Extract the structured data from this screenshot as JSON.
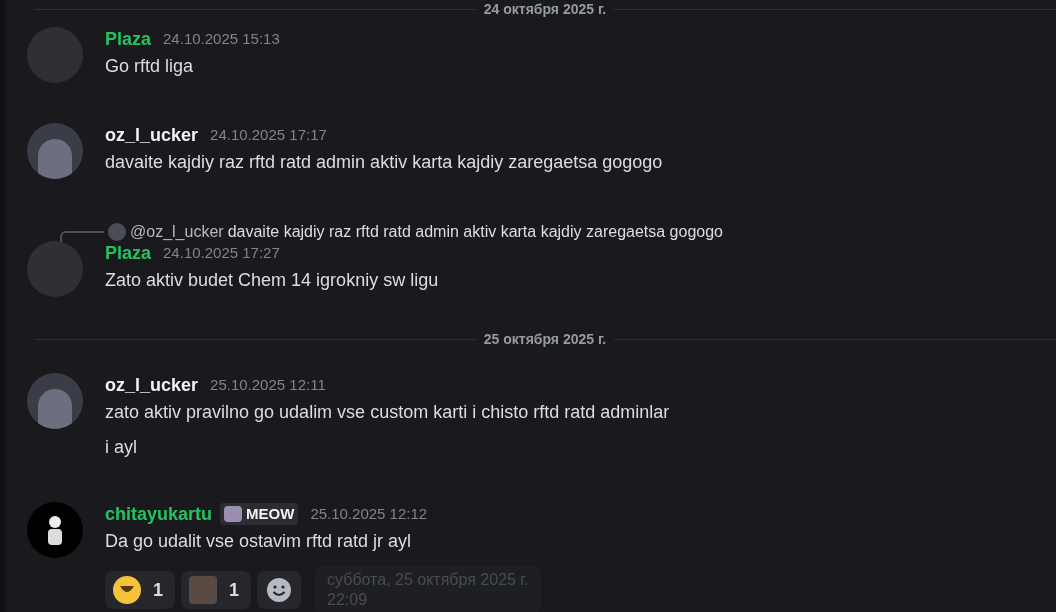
{
  "top_divider": {
    "label": "24 октября 2025 г."
  },
  "messages": [
    {
      "author": "Plaza",
      "color": "#23c45e",
      "timestamp": "24.10.2025 15:13",
      "avatar": {
        "kind": "blank"
      },
      "lines": [
        "Go rftd liga"
      ]
    },
    {
      "author": "oz_l_ucker",
      "color": "#f2f3f5",
      "timestamp": "24.10.2025 17:17",
      "avatar": {
        "kind": "image"
      },
      "lines": [
        "davaite kajdiy raz rftd ratd admin aktiv karta  kajdiy zaregaetsa gogogo"
      ]
    },
    {
      "author": "Plaza",
      "color": "#23c45e",
      "timestamp": "24.10.2025 17:27",
      "avatar": {
        "kind": "blank"
      },
      "reply": {
        "mention": "@oz_l_ucker",
        "text": "davaite kajdiy raz rftd ratd admin aktiv karta  kajdiy zaregaetsa gogogo"
      },
      "lines": [
        "Zato aktiv budet Chem 14 igrokniy sw ligu"
      ]
    },
    {
      "divider": "25 октября 2025 г.",
      "author": "oz_l_ucker",
      "color": "#f2f3f5",
      "timestamp": "25.10.2025 12:11",
      "avatar": {
        "kind": "image"
      },
      "lines": [
        "zato aktiv pravilno go udalim vse custom karti i chisto rftd ratd adminlar",
        "i ayl"
      ]
    },
    {
      "author": "chitayukartu",
      "color": "#23c45e",
      "timestamp": "25.10.2025 12:12",
      "avatar": {
        "kind": "dark"
      },
      "badge": "MEOW",
      "lines": [
        "Da go udalit vse ostavim rftd ratd jr ayl"
      ],
      "reactions": [
        {
          "kind": "emoji",
          "count": "1"
        },
        {
          "kind": "image",
          "count": "1"
        },
        {
          "kind": "add"
        }
      ],
      "tooltip": [
        "суббота, 25 октября 2025 г.",
        "22:09"
      ]
    }
  ]
}
